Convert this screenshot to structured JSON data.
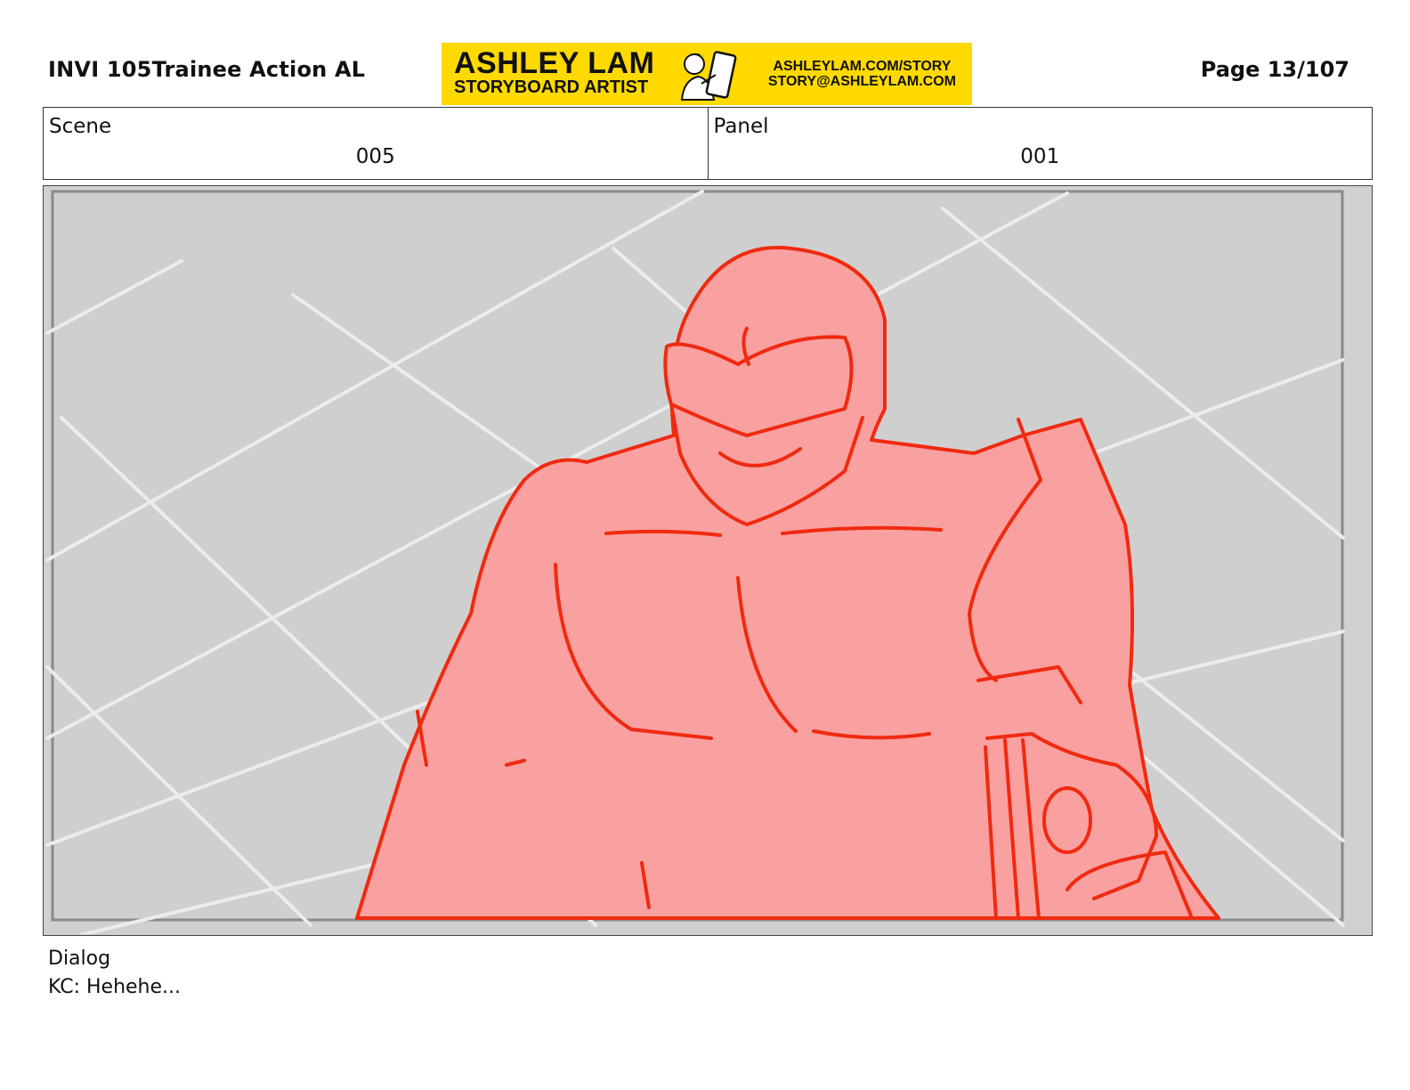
{
  "header": {
    "title": "INVI 105Trainee Action AL",
    "page_label": "Page  13/107"
  },
  "banner": {
    "name": "ASHLEY LAM",
    "role": "STORYBOARD ARTIST",
    "website": "ASHLEYLAM.COM/STORY",
    "email": "STORY@ASHLEYLAM.COM",
    "background_color": "#ffd900"
  },
  "info": {
    "scene_label": "Scene",
    "scene_value": "005",
    "panel_label": "Panel",
    "panel_value": "001"
  },
  "panel": {
    "description_colors": {
      "background": "#d0d0d0",
      "figure_fill": "#f9a0a0",
      "figure_line": "#f02a10",
      "grid_lines": "#ececec"
    }
  },
  "dialog": {
    "label": "Dialog",
    "text": "KC: Hehehe..."
  }
}
